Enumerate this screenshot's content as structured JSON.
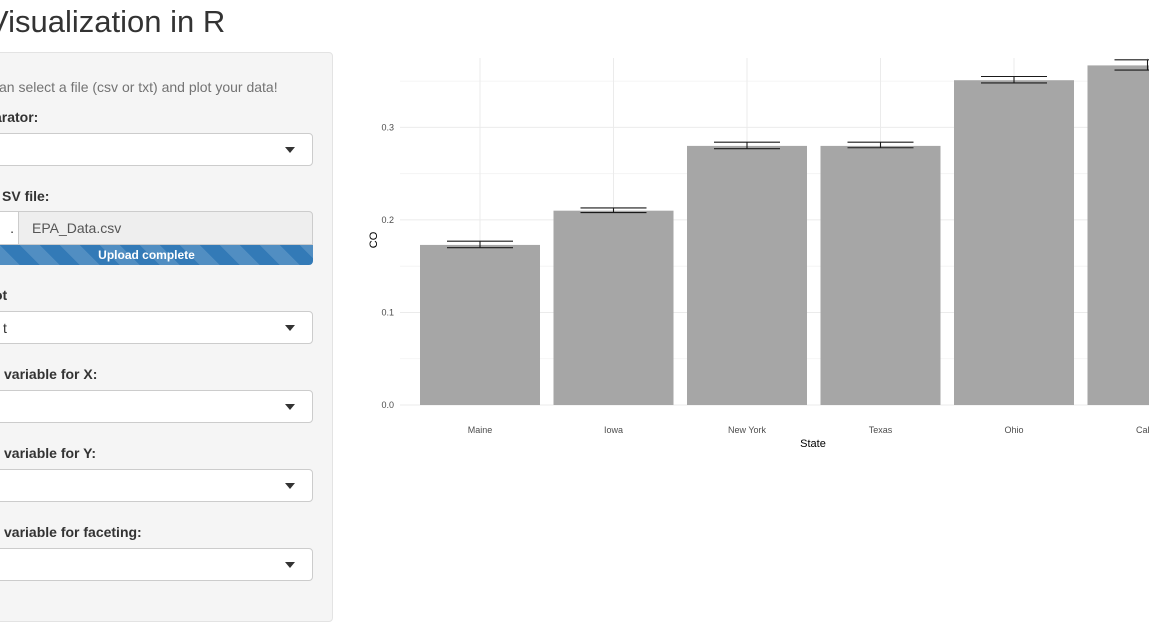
{
  "app": {
    "title": "Visualization in R"
  },
  "sidebar": {
    "help_text": "can select a file (csv or txt) and plot your data!",
    "separator": {
      "label": "arator:",
      "value": ""
    },
    "file_input": {
      "label": "SV file:",
      "browse_label": ".",
      "file_name": "EPA_Data.csv",
      "upload_status": "Upload complete",
      "progress_fraction": 1.0
    },
    "plot_type": {
      "label": "ot",
      "value": "t"
    },
    "x_var": {
      "label": "variable for X:",
      "value": ""
    },
    "y_var": {
      "label": "variable for Y:",
      "value": ""
    },
    "facet_var": {
      "label": "variable for faceting:",
      "value": ""
    }
  },
  "chart_data": {
    "type": "bar",
    "categories": [
      "Maine",
      "Iowa",
      "New York",
      "Texas",
      "Ohio",
      "Califo"
    ],
    "values": [
      0.173,
      0.21,
      0.28,
      0.28,
      0.351,
      0.367
    ],
    "error_low": [
      0.17,
      0.208,
      0.277,
      0.278,
      0.348,
      0.362
    ],
    "error_high": [
      0.177,
      0.213,
      0.284,
      0.284,
      0.355,
      0.373
    ],
    "xlabel": "State",
    "ylabel": "CO",
    "yticks": [
      "0.0",
      "0.1",
      "0.2",
      "0.3"
    ],
    "ylim": [
      0,
      0.375
    ],
    "grid": true,
    "bar_color": "#a6a6a6"
  }
}
